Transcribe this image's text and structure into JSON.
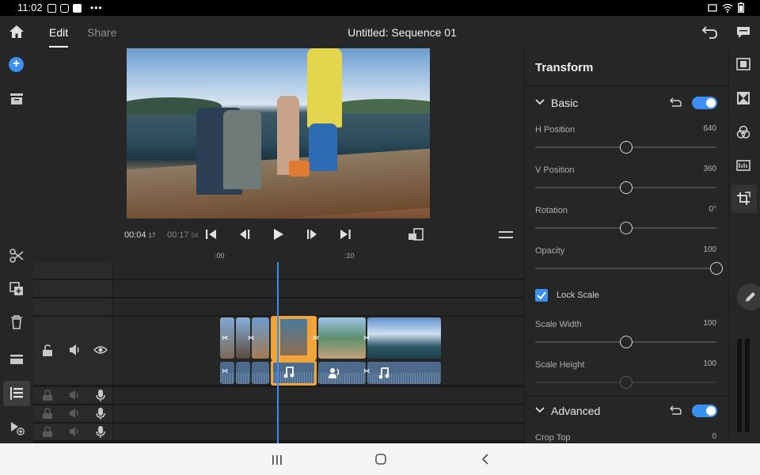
{
  "status_bar": {
    "time": "11:02",
    "notification_icons": [
      "gallery-icon",
      "youtube-icon",
      "facebook-icon"
    ],
    "more": "•••",
    "right_icons": [
      "cast-icon",
      "wifi-icon",
      "battery-icon"
    ]
  },
  "header": {
    "tabs": [
      {
        "label": "Edit",
        "active": true
      },
      {
        "label": "Share",
        "active": false
      }
    ],
    "title": "Untitled: Sequence 01"
  },
  "player": {
    "current_time": "00:04",
    "current_frames": "17",
    "duration": "00:17",
    "duration_frames": "04"
  },
  "timeline": {
    "ruler_labels": [
      ":00",
      ":10"
    ],
    "audio_track_icons": [
      "music-note-icon",
      "voiceover-icon",
      "music-note-icon"
    ]
  },
  "properties": {
    "title": "Transform",
    "basic": {
      "label": "Basic",
      "enabled": true,
      "params": [
        {
          "label": "H Position",
          "value": "640",
          "fraction": 0.5
        },
        {
          "label": "V Position",
          "value": "360",
          "fraction": 0.5
        },
        {
          "label": "Rotation",
          "value": "0°",
          "fraction": 0.5
        },
        {
          "label": "Opacity",
          "value": "100",
          "fraction": 1.0
        }
      ],
      "lock_scale": {
        "label": "Lock Scale",
        "checked": true
      },
      "scale": [
        {
          "label": "Scale Width",
          "value": "100",
          "fraction": 0.5
        },
        {
          "label": "Scale Height",
          "value": "100",
          "fraction": 0.5,
          "disabled": true
        }
      ]
    },
    "advanced": {
      "label": "Advanced",
      "enabled": true,
      "params": [
        {
          "label": "Crop Top",
          "value": "0"
        }
      ]
    }
  },
  "colors": {
    "accent": "#3a8ff0",
    "selected_clip": "#f0a53a",
    "audio_clip": "#4c6a8b",
    "panel": "#262626",
    "background": "#1d1d1d"
  }
}
